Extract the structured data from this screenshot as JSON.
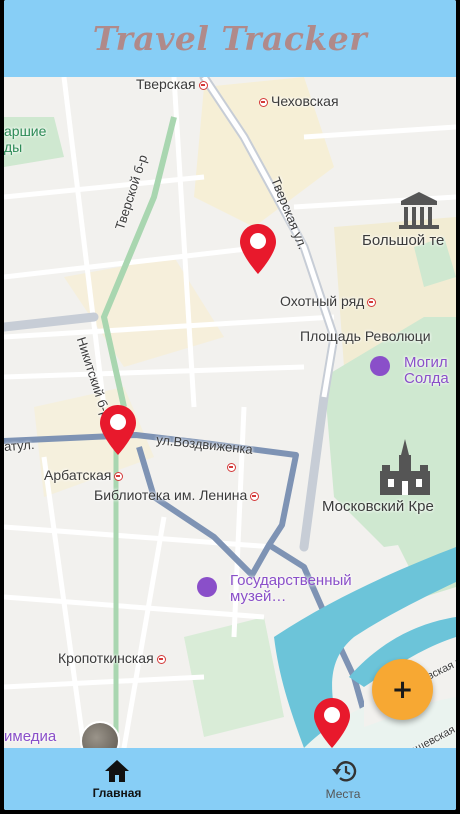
{
  "app": {
    "title": "Travel Tracker"
  },
  "map": {
    "labels": {
      "tverskaya": "Тверская",
      "chekhovskaya": "Чеховская",
      "park_line1": "аршие",
      "park_line2": "ды",
      "tverskoy_blvd": "Тверской б-р",
      "tverskaya_st": "Тверская ул.",
      "bolshoi": "Большой те",
      "okhotny": "Охотный ряд",
      "ploshchad": "Площадь Революци",
      "mogila1": "Могил",
      "mogila2": "Солда",
      "nikitsky": "Никитский б-р",
      "arbat_st": "атул.",
      "vozdvizhenka": "ул.Воздвиженка",
      "arbatskaya": "Арбатская",
      "lenin_library": "Библиотека им. Ленина",
      "kremlin": "Московский Кре",
      "museum1": "Государственный",
      "museum2": "музей…",
      "kropotkinskaya": "Кропоткинская",
      "media": "имедиа",
      "bersenevskaya": "Берсеневская наб.",
      "kadashevskaya": "Кадашевская"
    },
    "pin_color": "#e8192c"
  },
  "fab": {
    "label": "+",
    "color": "#f7a833"
  },
  "nav": {
    "home_label": "Главная",
    "places_label": "Места",
    "home_icon": "home-icon",
    "places_icon": "history-icon"
  },
  "colors": {
    "app_bar": "#87cef6",
    "title": "#b08a8a"
  }
}
